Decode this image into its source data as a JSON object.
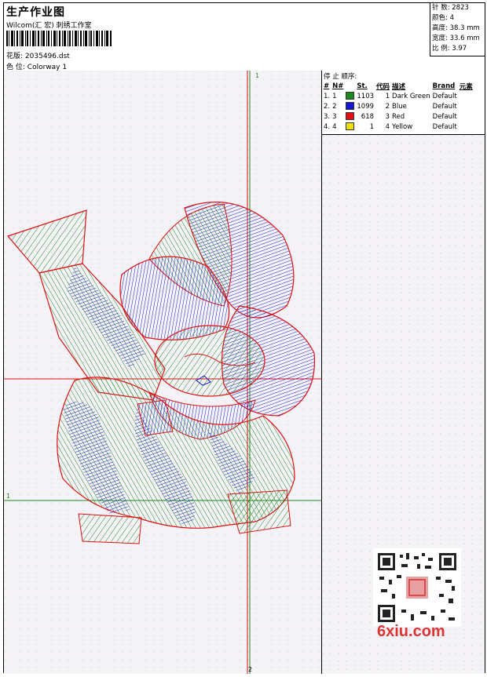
{
  "header": {
    "title": "生产作业图",
    "company": "Wilcom(汇 宏) 刺绣工作室",
    "design_label": "花版:",
    "design_file": "2035496.dst",
    "colorway_label": "色 位:",
    "colorway": "Colorway 1"
  },
  "stats": {
    "stitches": "针 数: 2823",
    "colors": "颜色: 4",
    "height": "高度: 38.3 mm",
    "width": "宽度: 33.6 mm",
    "scale": "比 例: 3.97"
  },
  "stop_panel": {
    "title": "停 止 顺序:",
    "columns": [
      "#",
      "N#",
      "St.",
      "代码",
      "描述",
      "Brand",
      "元素"
    ],
    "rows": [
      {
        "idx": "1.",
        "n": "1",
        "color": "#1a8a1a",
        "st": "1103",
        "code": "1",
        "desc": "Dark Green",
        "brand": "Default"
      },
      {
        "idx": "2.",
        "n": "2",
        "color": "#1515d6",
        "st": "1099",
        "code": "2",
        "desc": "Blue",
        "brand": "Default"
      },
      {
        "idx": "3.",
        "n": "3",
        "color": "#e01010",
        "st": "618",
        "code": "3",
        "desc": "Red",
        "brand": "Default"
      },
      {
        "idx": "4.",
        "n": "4",
        "color": "#f0e000",
        "st": "1",
        "code": "4",
        "desc": "Yellow",
        "brand": "Default"
      }
    ]
  },
  "axes": {
    "top": "1",
    "bottom": "2",
    "left": "1"
  },
  "watermark": {
    "text": "6xiu.com"
  }
}
